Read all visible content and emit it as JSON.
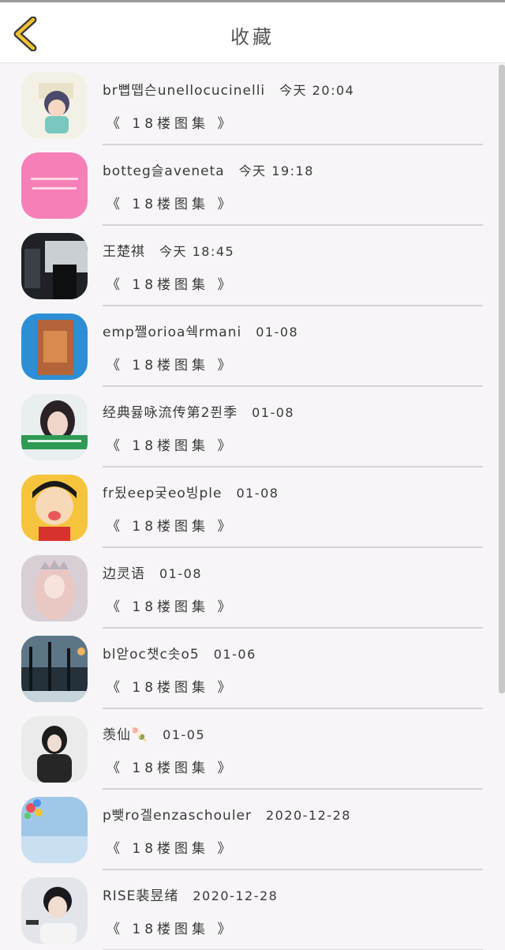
{
  "header": {
    "title": "收藏",
    "back_icon": "chevron-left-icon",
    "accent": "#f2c230"
  },
  "items": [
    {
      "name": "br뼙뗍슨unellocucinelli",
      "time": "今天 20:04",
      "board": "《 18楼图集 》"
    },
    {
      "name": "botteg슬aveneta",
      "time": "今天 19:18",
      "board": "《 18楼图集 》"
    },
    {
      "name": "王楚祺",
      "time": "今天 18:45",
      "board": "《 18楼图集 》"
    },
    {
      "name": "emp쨀orioa쉑rmani",
      "time": "01-08",
      "board": "《 18楼图集 》"
    },
    {
      "name": "经典뮳咏流传第2퓐季",
      "time": "01-08",
      "board": "《 18楼图集 》"
    },
    {
      "name": "fr됬eep궂eo빙ple",
      "time": "01-08",
      "board": "《 18楼图集 》"
    },
    {
      "name": "边灵语",
      "time": "01-08",
      "board": "《 18楼图集 》"
    },
    {
      "name": "bl앋oc챗c솟o5",
      "time": "01-06",
      "board": "《 18楼图集 》"
    },
    {
      "name": "羡仙🍡",
      "time": "01-05",
      "board": "《 18楼图集 》"
    },
    {
      "name": "p뺒ro겔enzaschouler",
      "time": "2020-12-28",
      "board": "《 18楼图集 》"
    },
    {
      "name": "RISE裴昱绪",
      "time": "2020-12-28",
      "board": "《 18楼图集 》"
    }
  ]
}
